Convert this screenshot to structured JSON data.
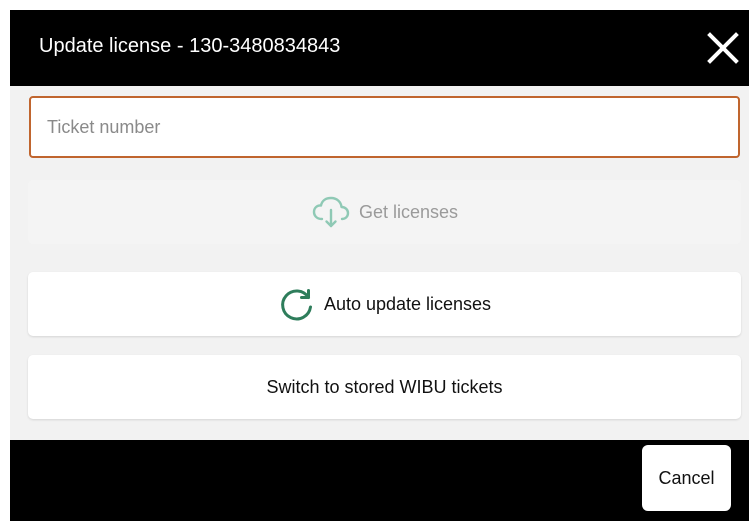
{
  "dialog": {
    "title": "Update license - 130-3480834843",
    "close_icon": "close-icon"
  },
  "ticket_input": {
    "placeholder": "Ticket number",
    "value": ""
  },
  "buttons": {
    "get_licenses": {
      "label": "Get licenses",
      "icon": "cloud-download-icon",
      "disabled": true
    },
    "auto_update": {
      "label": "Auto update licenses",
      "icon": "refresh-icon"
    },
    "switch_tickets": {
      "label": "Switch to stored WIBU tickets"
    }
  },
  "footer": {
    "cancel_label": "Cancel"
  },
  "colors": {
    "titlebar_bg": "#000000",
    "input_border": "#c0652e",
    "accent_green": "#2e7d5b",
    "disabled_green": "#8fc9b5"
  }
}
